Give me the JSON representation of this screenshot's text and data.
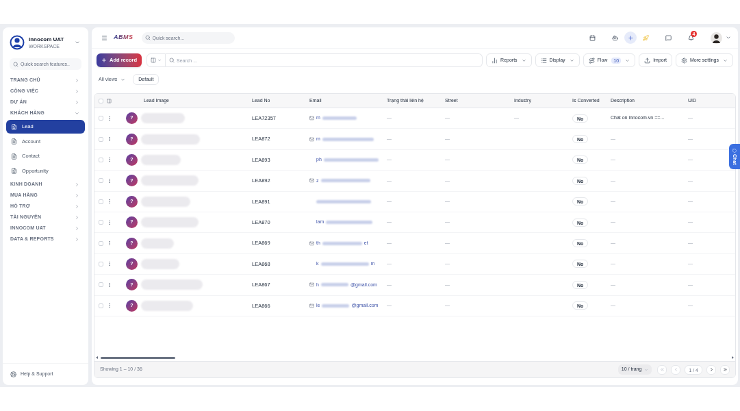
{
  "sidebar": {
    "workspace": {
      "name": "Innocom UAT",
      "subtitle": "WORKSPACE"
    },
    "search": {
      "placeholder": "Quick search features.."
    },
    "sections": [
      {
        "label": "TRANG CHỦ",
        "expanded": false
      },
      {
        "label": "CÔNG VIỆC",
        "expanded": false
      },
      {
        "label": "DỰ ÁN",
        "expanded": false
      },
      {
        "label": "KHÁCH HÀNG",
        "expanded": true,
        "children": [
          {
            "label": "Lead",
            "selected": true
          },
          {
            "label": "Account",
            "selected": false
          },
          {
            "label": "Contact",
            "selected": false
          },
          {
            "label": "Opportunity",
            "selected": false
          }
        ]
      },
      {
        "label": "KINH DOANH",
        "expanded": false
      },
      {
        "label": "MUA HÀNG",
        "expanded": false
      },
      {
        "label": "HỖ TRỢ",
        "expanded": false
      },
      {
        "label": "TÀI NGUYÊN",
        "expanded": false
      },
      {
        "label": "INNOCOM UAT",
        "expanded": false
      },
      {
        "label": "DATA & REPORTS",
        "expanded": false
      }
    ],
    "help": "Help & Support"
  },
  "topbar": {
    "logo": "ABMS",
    "search": {
      "placeholder": "Quick search..."
    },
    "notification_count": "4"
  },
  "toolbar": {
    "add_button": "Add record",
    "search": {
      "placeholder": "Search ..."
    },
    "buttons": [
      {
        "kind": "reports",
        "label": "Reports",
        "caret": true
      },
      {
        "kind": "display",
        "label": "Display",
        "caret": true
      },
      {
        "kind": "flow",
        "label": "Flow",
        "badge": "10",
        "caret": true
      },
      {
        "kind": "import",
        "label": "Import",
        "caret": false
      },
      {
        "kind": "settings",
        "label": "More settings",
        "caret": true
      }
    ]
  },
  "views": {
    "label": "All views",
    "default_button": "Default"
  },
  "table": {
    "all_checked": false,
    "columns": [
      "Lead Image",
      "Lead No",
      "Email",
      "Trạng thái liên hệ",
      "Street",
      "Industry",
      "Is Converted",
      "Description",
      "UID"
    ],
    "rows": [
      {
        "checked": false,
        "avatar": "?",
        "lead_no": "LEA72357",
        "email_icon": true,
        "email_start": "m",
        "contact_status": "—",
        "street": "—",
        "industry": "—",
        "is_converted": "No",
        "description": "Chat on innocom.vn ==...",
        "uid": "—"
      },
      {
        "checked": false,
        "avatar": "?",
        "lead_no": "LEA872",
        "email_icon": true,
        "email_start": "m",
        "contact_status": "—",
        "street": "—",
        "is_converted": "No",
        "description": "—",
        "uid": "—"
      },
      {
        "checked": false,
        "avatar": "?",
        "lead_no": "LEA893",
        "email_icon": false,
        "email_start": "ph",
        "contact_status": "—",
        "street": "—",
        "is_converted": "No",
        "description": "—",
        "uid": "—"
      },
      {
        "checked": false,
        "avatar": "?",
        "lead_no": "LEA892",
        "email_icon": true,
        "email_start": "z",
        "contact_status": "—",
        "street": "—",
        "is_converted": "No",
        "description": "—",
        "uid": "—"
      },
      {
        "checked": false,
        "avatar": "?",
        "lead_no": "LEA891",
        "email_icon": false,
        "contact_status": "—",
        "street": "—",
        "is_converted": "No",
        "description": "—",
        "uid": "—"
      },
      {
        "checked": false,
        "avatar": "?",
        "lead_no": "LEA870",
        "email_icon": false,
        "email_start": "lam",
        "contact_status": "—",
        "street": "—",
        "is_converted": "No",
        "description": "—",
        "uid": "—"
      },
      {
        "checked": false,
        "avatar": "?",
        "lead_no": "LEA869",
        "email_icon": true,
        "email_start": "th",
        "email_end": "et",
        "contact_status": "—",
        "street": "—",
        "is_converted": "No",
        "description": "—",
        "uid": "—"
      },
      {
        "checked": false,
        "avatar": "?",
        "lead_no": "LEA868",
        "email_icon": false,
        "email_start": "k",
        "email_end": "m",
        "contact_status": "—",
        "street": "—",
        "is_converted": "No",
        "description": "—",
        "uid": "—"
      },
      {
        "checked": false,
        "avatar": "?",
        "lead_no": "LEA867",
        "email_icon": true,
        "email_start": "h",
        "email_end": "@gmail.com",
        "contact_status": "—",
        "street": "—",
        "is_converted": "No",
        "description": "—",
        "uid": "—"
      },
      {
        "checked": false,
        "avatar": "?",
        "lead_no": "LEA866",
        "email_icon": true,
        "email_start": "le",
        "email_end": "@gmail.com",
        "contact_status": "—",
        "street": "—",
        "is_converted": "No",
        "description": "—",
        "uid": "—"
      }
    ]
  },
  "footer": {
    "showing": "Showing 1 – 10 / 36",
    "page_size": "10 / trang",
    "page": "1 / 4"
  },
  "chat_tab": "Chat"
}
